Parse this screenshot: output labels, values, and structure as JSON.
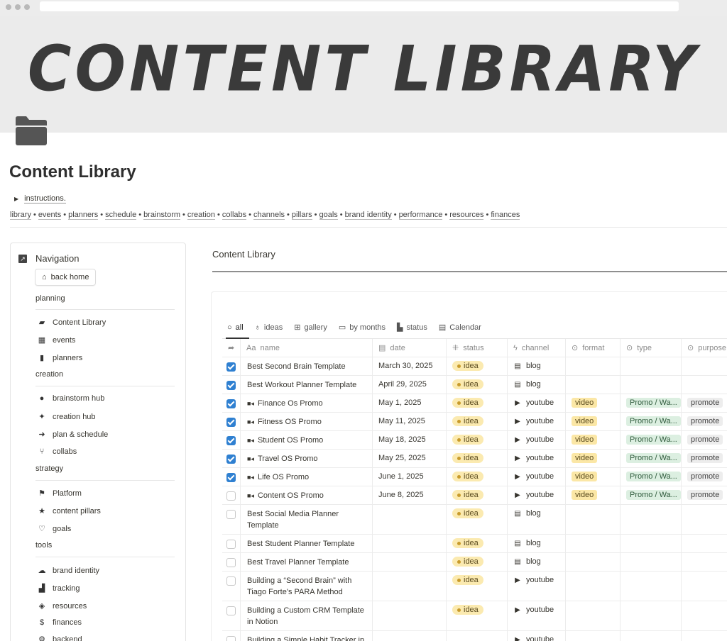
{
  "cover": {
    "title": "CONTENT LIBRARY"
  },
  "page": {
    "title": "Content Library",
    "toggle_label": "instructions."
  },
  "breadcrumbs": [
    "library",
    "events",
    "planners",
    "schedule",
    "brainstorm",
    "creation",
    "collabs",
    "channels",
    "pillars",
    "goals",
    "brand identity",
    "performance",
    "resources",
    "finances"
  ],
  "nav": {
    "title": "Navigation",
    "back_home": "back home",
    "sections": {
      "planning": "planning",
      "creation": "creation",
      "strategy": "strategy",
      "tools": "tools"
    },
    "items": {
      "content_library": "Content Library",
      "events": "events",
      "planners": "planners",
      "brainstorm_hub": "brainstorm hub",
      "creation_hub": "creation hub",
      "plan_schedule": "plan & schedule",
      "collabs": "collabs",
      "platform": "Platform",
      "content_pillars": "content pillars",
      "goals": "goals",
      "brand_identity": "brand identity",
      "tracking": "tracking",
      "resources": "resources",
      "finances": "finances",
      "backend": "backend"
    }
  },
  "main": {
    "title": "Content Library"
  },
  "views": {
    "all": "all",
    "ideas": "ideas",
    "gallery": "gallery",
    "by_months": "by months",
    "status": "status",
    "calendar": "Calendar"
  },
  "columns": {
    "name": "name",
    "date": "date",
    "status": "status",
    "channel": "channel",
    "format": "format",
    "type": "type",
    "purpose": "purpose"
  },
  "rows": [
    {
      "checked": true,
      "video": false,
      "name": "Best Second Brain Template",
      "date": "March 30, 2025",
      "status": "idea",
      "channel": "blog",
      "format": "",
      "type": "",
      "purpose": ""
    },
    {
      "checked": true,
      "video": false,
      "name": "Best Workout Planner Template",
      "date": "April 29, 2025",
      "status": "idea",
      "channel": "blog",
      "format": "",
      "type": "",
      "purpose": ""
    },
    {
      "checked": true,
      "video": true,
      "name": "Finance Os Promo",
      "date": "May 1, 2025",
      "status": "idea",
      "channel": "youtube",
      "format": "video",
      "type": "Promo / Wa...",
      "purpose": "promote"
    },
    {
      "checked": true,
      "video": true,
      "name": "Fitness OS Promo",
      "date": "May 11, 2025",
      "status": "idea",
      "channel": "youtube",
      "format": "video",
      "type": "Promo / Wa...",
      "purpose": "promote"
    },
    {
      "checked": true,
      "video": true,
      "name": "Student OS Promo",
      "date": "May 18, 2025",
      "status": "idea",
      "channel": "youtube",
      "format": "video",
      "type": "Promo / Wa...",
      "purpose": "promote"
    },
    {
      "checked": true,
      "video": true,
      "name": "Travel OS Promo",
      "date": "May 25, 2025",
      "status": "idea",
      "channel": "youtube",
      "format": "video",
      "type": "Promo / Wa...",
      "purpose": "promote"
    },
    {
      "checked": true,
      "video": true,
      "name": "Life OS Promo",
      "date": "June 1, 2025",
      "status": "idea",
      "channel": "youtube",
      "format": "video",
      "type": "Promo / Wa...",
      "purpose": "promote"
    },
    {
      "checked": false,
      "video": true,
      "name": "Content OS Promo",
      "date": "June 8, 2025",
      "status": "idea",
      "channel": "youtube",
      "format": "video",
      "type": "Promo / Wa...",
      "purpose": "promote"
    },
    {
      "checked": false,
      "video": false,
      "name": "Best Social Media Planner Template",
      "date": "",
      "status": "idea",
      "channel": "blog",
      "format": "",
      "type": "",
      "purpose": ""
    },
    {
      "checked": false,
      "video": false,
      "name": "Best Student Planner Template",
      "date": "",
      "status": "idea",
      "channel": "blog",
      "format": "",
      "type": "",
      "purpose": ""
    },
    {
      "checked": false,
      "video": false,
      "name": "Best Travel Planner Template",
      "date": "",
      "status": "idea",
      "channel": "blog",
      "format": "",
      "type": "",
      "purpose": ""
    },
    {
      "checked": false,
      "video": false,
      "name": "Building a “Second Brain” with Tiago Forte's PARA Method",
      "date": "",
      "status": "idea",
      "channel": "youtube",
      "format": "",
      "type": "",
      "purpose": ""
    },
    {
      "checked": false,
      "video": false,
      "name": "Building a Custom CRM Template in Notion",
      "date": "",
      "status": "idea",
      "channel": "youtube",
      "format": "",
      "type": "",
      "purpose": ""
    },
    {
      "checked": false,
      "video": false,
      "name": "Building a Simple Habit Tracker in",
      "date": "",
      "status": "",
      "channel": "youtube",
      "format": "",
      "type": "",
      "purpose": ""
    }
  ]
}
